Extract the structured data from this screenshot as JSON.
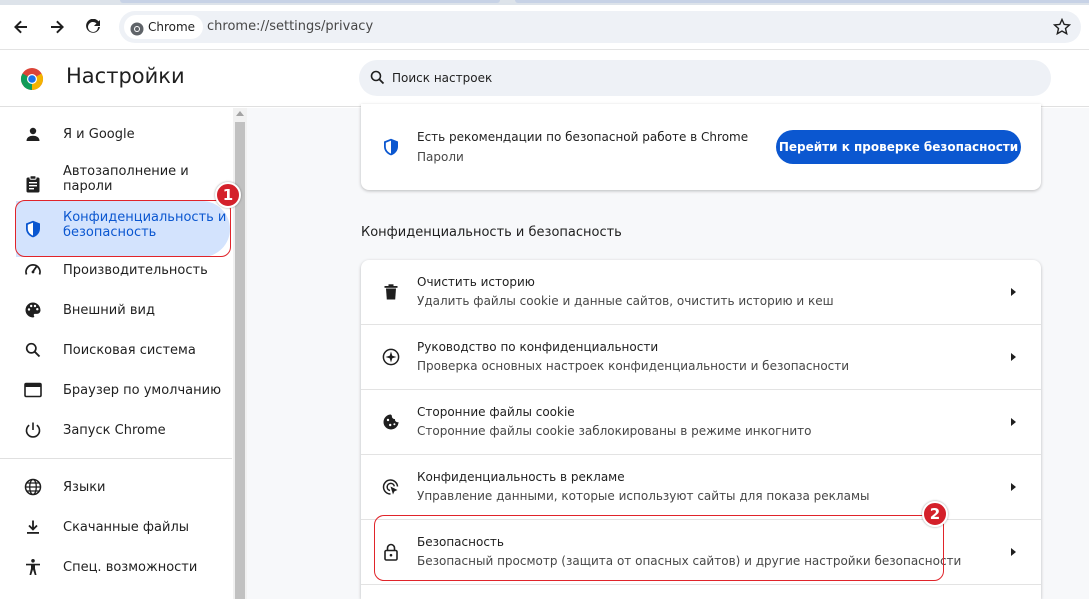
{
  "browser": {
    "chip_label": "Chrome",
    "url": "chrome://settings/privacy"
  },
  "header": {
    "title": "Настройки",
    "search_placeholder": "Поиск настроек"
  },
  "sidebar": {
    "items": [
      {
        "label": "Я и Google",
        "icon": "person-icon"
      },
      {
        "label": "Автозаполнение и\nпароли",
        "icon": "clipboard-icon"
      },
      {
        "label": "Конфиденциальность и\nбезопасность",
        "icon": "shield-icon",
        "active": true
      },
      {
        "label": "Производительность",
        "icon": "speedometer-icon"
      },
      {
        "label": "Внешний вид",
        "icon": "palette-icon"
      },
      {
        "label": "Поисковая система",
        "icon": "search-icon"
      },
      {
        "label": "Браузер по умолчанию",
        "icon": "browser-window-icon"
      },
      {
        "label": "Запуск Chrome",
        "icon": "power-icon"
      },
      {
        "label": "Языки",
        "icon": "globe-icon"
      },
      {
        "label": "Скачанные файлы",
        "icon": "download-icon"
      },
      {
        "label": "Спец. возможности",
        "icon": "accessibility-icon"
      }
    ]
  },
  "safety_card": {
    "title": "Есть рекомендации по безопасной работе в Chrome",
    "subtitle": "Пароли",
    "button_label": "Перейти к проверке безопасности"
  },
  "privacy_section": {
    "title": "Конфиденциальность и безопасность",
    "rows": [
      {
        "title": "Очистить историю",
        "subtitle": "Удалить файлы cookie и данные сайтов, очистить историю и кеш",
        "icon": "trash-icon"
      },
      {
        "title": "Руководство по конфиденциальности",
        "subtitle": "Проверка основных настроек конфиденциальности и безопасности",
        "icon": "compass-icon"
      },
      {
        "title": "Сторонние файлы cookie",
        "subtitle": "Сторонние файлы cookie заблокированы в режиме инкогнито",
        "icon": "cookie-icon"
      },
      {
        "title": "Конфиденциальность в рекламе",
        "subtitle": "Управление данными, которые используют сайты для показа рекламы",
        "icon": "ads-icon"
      },
      {
        "title": "Безопасность",
        "subtitle": "Безопасный просмотр (защита от опасных сайтов) и другие настройки безопасности",
        "icon": "lock-icon"
      }
    ]
  },
  "annotations": {
    "badge_1": "1",
    "badge_2": "2"
  },
  "colors": {
    "accent": "#0b57d0",
    "active_bg": "#d3e3fd",
    "annotation": "#d4202a"
  }
}
